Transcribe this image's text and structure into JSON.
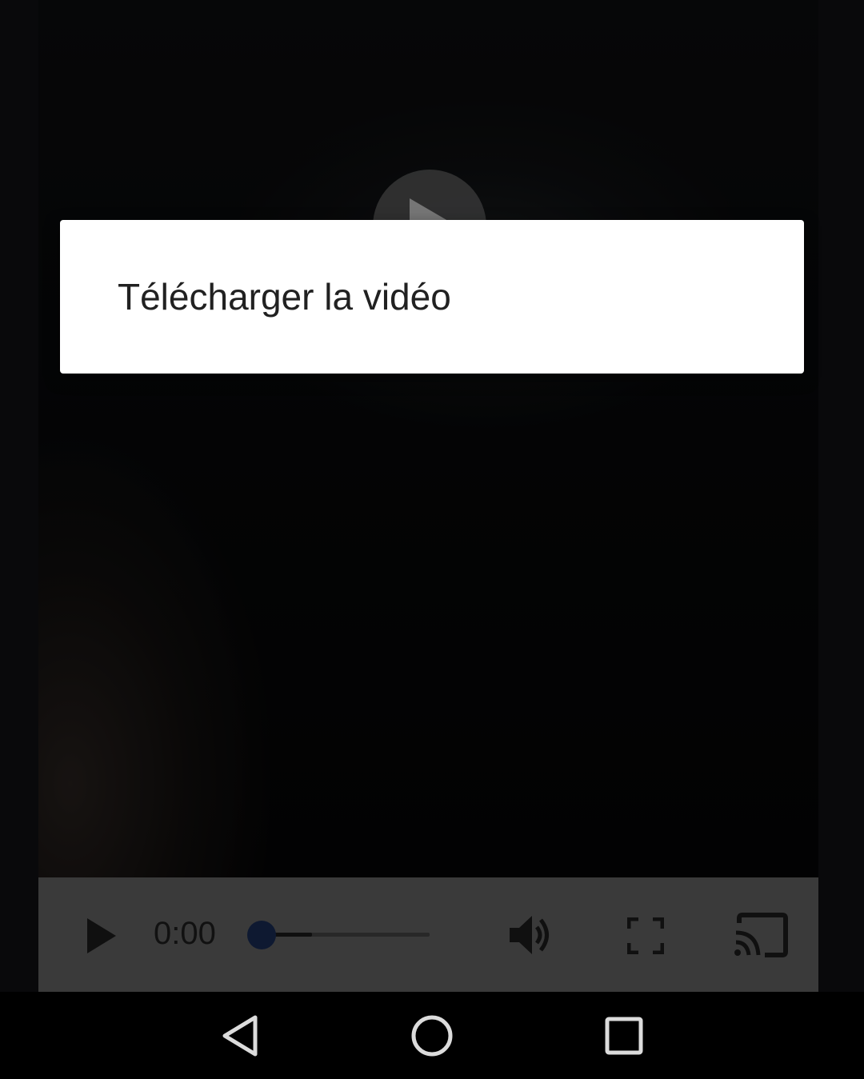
{
  "video": {
    "current_time": "0:00",
    "progress_buffered": 0.3,
    "progress_played": 0.0
  },
  "dialog": {
    "items": [
      {
        "label": "Télécharger la vidéo"
      }
    ]
  },
  "icons": {
    "big_play": "play-icon",
    "controls_play": "play-icon",
    "volume": "volume-icon",
    "fullscreen": "fullscreen-icon",
    "cast": "cast-icon",
    "nav_back": "back-triangle-icon",
    "nav_home": "home-circle-icon",
    "nav_recents": "recents-square-icon"
  },
  "colors": {
    "progress_thumb": "#1b2f5a",
    "controls_bar": "#6b6b6b",
    "dialog_bg": "#ffffff"
  }
}
